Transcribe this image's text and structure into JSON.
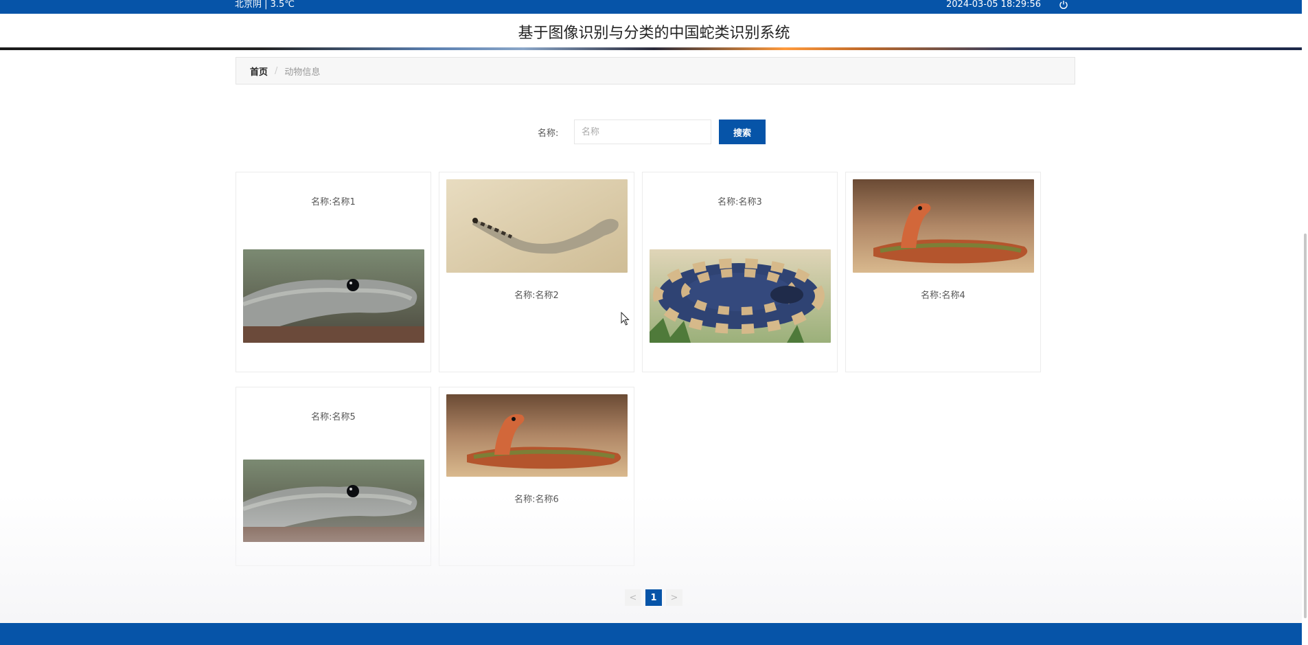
{
  "topbar": {
    "weather": "北京阴 | 3.5℃",
    "datetime": "2024-03-05   18:29:56",
    "power_icon": "power-icon"
  },
  "header": {
    "title": "基于图像识别与分类的中国蛇类识别系统"
  },
  "breadcrumb": {
    "home": "首页",
    "separator": "/",
    "current": "动物信息"
  },
  "search": {
    "label": "名称:",
    "placeholder": "名称",
    "value": "",
    "button": "搜索"
  },
  "cards": [
    {
      "name": "名称:名称1",
      "image": "black-mamba-head"
    },
    {
      "name": "名称:名称2",
      "image": "sand-snake"
    },
    {
      "name": "名称:名称3",
      "image": "banded-krait"
    },
    {
      "name": "名称:名称4",
      "image": "red-neck-snake"
    },
    {
      "name": "名称:名称5",
      "image": "black-mamba-head"
    },
    {
      "name": "名称:名称6",
      "image": "red-neck-snake"
    }
  ],
  "pagination": {
    "prev": "<",
    "current": "1",
    "next": ">"
  },
  "colors": {
    "primary": "#0654a8",
    "breadcrumb_bg": "#f7f7f7"
  }
}
